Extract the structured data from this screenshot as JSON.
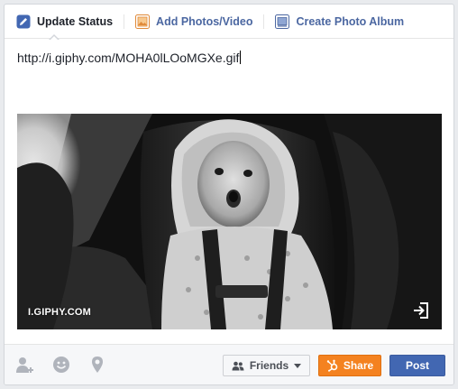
{
  "tabs": [
    {
      "label": "Update Status",
      "icon": "pencil-icon",
      "active": true
    },
    {
      "label": "Add Photos/Video",
      "icon": "photo-icon",
      "active": false
    },
    {
      "label": "Create Photo Album",
      "icon": "album-icon",
      "active": false
    }
  ],
  "status": {
    "text": "http://i.giphy.com/MOHA0lLOoMGXe.gif"
  },
  "preview": {
    "source_label": "I.GIPHY.COM",
    "open_icon": "open-in-icon"
  },
  "footer": {
    "icons": [
      "tag-friends-icon",
      "feeling-icon",
      "location-icon"
    ],
    "audience_label": "Friends",
    "share_label": "Share",
    "post_label": "Post"
  },
  "colors": {
    "accent": "#4267b2",
    "share": "#f48220",
    "tab_link": "#4b67a1"
  }
}
